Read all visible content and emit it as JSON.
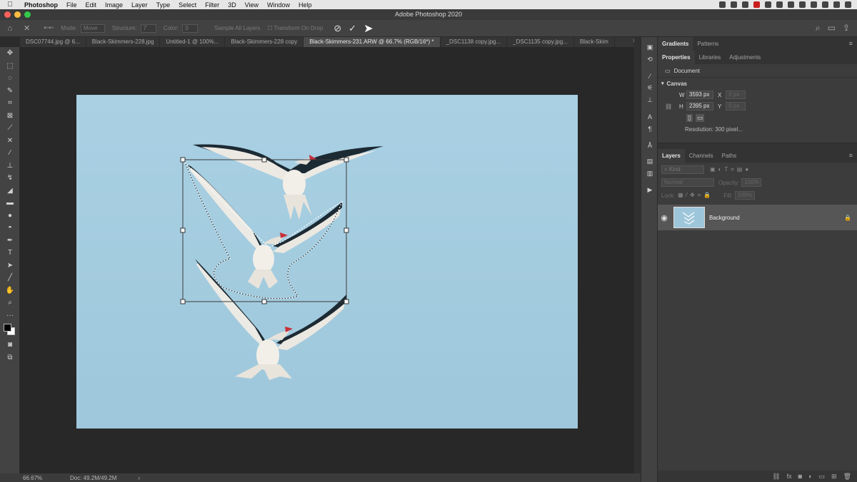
{
  "menubar": {
    "items": [
      "Photoshop",
      "File",
      "Edit",
      "Image",
      "Layer",
      "Type",
      "Select",
      "Filter",
      "3D",
      "View",
      "Window",
      "Help"
    ]
  },
  "window": {
    "title": "Adobe Photoshop 2020"
  },
  "options_bar": {
    "mode_label": "Mode:",
    "mode_value": "Move",
    "structure_label": "Structure:",
    "structure_value": "7",
    "color_label": "Color:",
    "color_value": "0",
    "sample_all_layers": "Sample All Layers",
    "transform_on_drop": "Transform On Drop"
  },
  "tabs": [
    {
      "label": "DSC07744.jpg @ 6...",
      "active": false
    },
    {
      "label": "Black-Skimmers-228.jpg",
      "active": false
    },
    {
      "label": "Untitled-1 @ 100%...",
      "active": false
    },
    {
      "label": "Black-Skimmers-228 copy",
      "active": false
    },
    {
      "label": "Black-Skimmers-231.ARW @ 66.7% (RGB/16*) *",
      "active": true
    },
    {
      "label": "_DSC1138 copy.jpg...",
      "active": false
    },
    {
      "label": "_DSC1135 copy.jpg...",
      "active": false
    },
    {
      "label": "Black-Skim",
      "active": false
    }
  ],
  "statusbar": {
    "zoom": "66.67%",
    "doc": "Doc: 49.2M/49.2M",
    "arrow": "›"
  },
  "top_panel": {
    "tabs": [
      "Gradients",
      "Patterns"
    ]
  },
  "properties_panel": {
    "tabs": [
      "Properties",
      "Libraries",
      "Adjustments"
    ],
    "document_label": "Document",
    "canvas_label": "Canvas",
    "w_label": "W",
    "w_value": "3593 px",
    "x_label": "X",
    "x_value": "0 px",
    "h_label": "H",
    "h_value": "2395 px",
    "y_label": "Y",
    "y_value": "0 px",
    "resolution": "Resolution: 300 pixel..."
  },
  "layers_panel": {
    "tabs": [
      "Layers",
      "Channels",
      "Paths"
    ],
    "kind_placeholder": "Kind",
    "blend_mode": "Normal",
    "opacity_label": "Opacity:",
    "opacity_value": "100%",
    "lock_label": "Lock:",
    "fill_label": "Fill:",
    "fill_value": "100%",
    "layers": [
      {
        "name": "Background",
        "visible": true,
        "locked": true
      }
    ]
  },
  "colors": {
    "sky": "#a6cde0",
    "selection_accent": "#ffffff"
  }
}
